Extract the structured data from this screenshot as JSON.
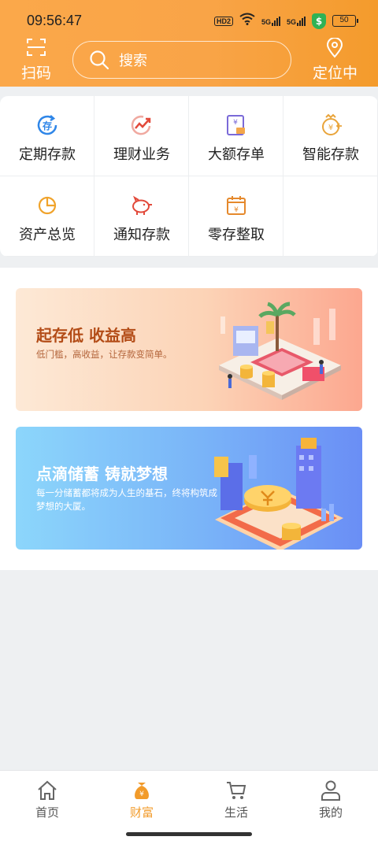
{
  "status_bar": {
    "time": "09:56:47",
    "hd": "HD2",
    "signal1": "5G",
    "signal2": "5G",
    "shield_icon": "dollar-shield-icon",
    "battery": "50"
  },
  "header": {
    "scan_label": "扫码",
    "search_placeholder": "搜索",
    "locate_label": "定位中",
    "background": "#f9a447"
  },
  "services": [
    {
      "label": "定期存款",
      "icon": "fixed-deposit-icon",
      "color": "#2f86e8"
    },
    {
      "label": "理财业务",
      "icon": "wealth-trend-icon",
      "color": "#e2493a"
    },
    {
      "label": "大额存单",
      "icon": "large-deposit-icon",
      "color": "#7a6ad8"
    },
    {
      "label": "智能存款",
      "icon": "smart-deposit-icon",
      "color": "#e9a43a"
    },
    {
      "label": "资产总览",
      "icon": "asset-pie-icon",
      "color": "#f0a32b"
    },
    {
      "label": "通知存款",
      "icon": "piggy-bank-icon",
      "color": "#e2493a"
    },
    {
      "label": "零存整取",
      "icon": "calendar-deposit-icon",
      "color": "#e5892c"
    }
  ],
  "banners": [
    {
      "title": "起存低 收益高",
      "desc": "低门槛，高收益，让存款变简单。"
    },
    {
      "title": "点滴储蓄 铸就梦想",
      "desc": "每一分储蓄都将成为人生的基石，终将构筑成梦想的大厦。"
    }
  ],
  "tabbar": {
    "active": "财富",
    "active_color": "#f29b2a",
    "tabs": [
      {
        "label": "首页",
        "icon": "home-icon"
      },
      {
        "label": "财富",
        "icon": "money-bag-icon"
      },
      {
        "label": "生活",
        "icon": "shopping-cart-icon"
      },
      {
        "label": "我的",
        "icon": "user-icon"
      }
    ]
  }
}
